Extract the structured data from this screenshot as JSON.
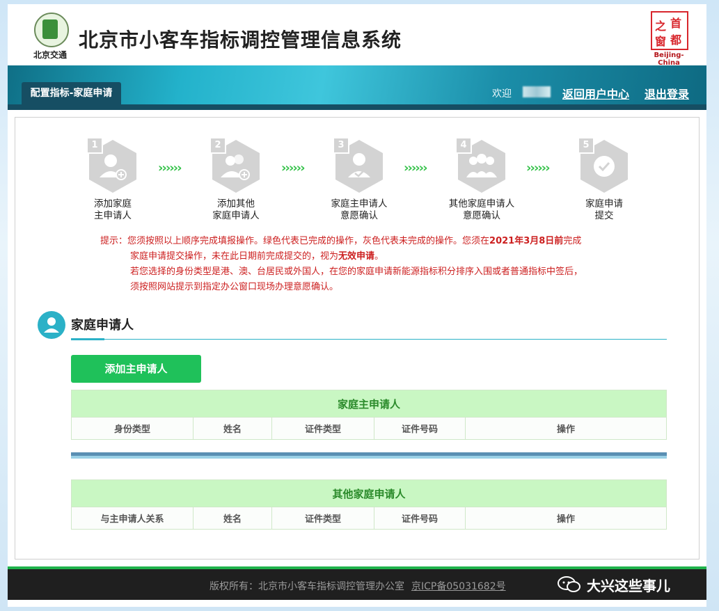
{
  "header": {
    "title": "北京市小客车指标调控管理信息系统",
    "logo_left_text": "北京交通",
    "logo_right_chars": [
      "首",
      "都",
      "之",
      "窗"
    ],
    "logo_right_caption": "Beijing-China"
  },
  "nav": {
    "active_tab": "配置指标-家庭申请",
    "welcome": "欢迎",
    "user_center": "返回用户中心",
    "logout": "退出登录"
  },
  "steps": [
    {
      "num": "1",
      "line1": "添加家庭",
      "line2": "主申请人",
      "icon": "add-user-icon"
    },
    {
      "num": "2",
      "line1": "添加其他",
      "line2": "家庭申请人",
      "icon": "add-users-icon"
    },
    {
      "num": "3",
      "line1": "家庭主申请人",
      "line2": "意愿确认",
      "icon": "user-check-icon"
    },
    {
      "num": "4",
      "line1": "其他家庭申请人",
      "line2": "意愿确认",
      "icon": "group-check-icon"
    },
    {
      "num": "5",
      "line1": "家庭申请",
      "line2": "提交",
      "icon": "check-circle-icon"
    }
  ],
  "step_arrows": "››››››",
  "tips": {
    "label": "提示：",
    "line1_a": "您须按照以上顺序完成填报操作。绿色代表已完成的操作，灰色代表未完成的操作。您须在",
    "line1_date": "2021年3月8日前",
    "line1_b": "完成",
    "line2_a": "家庭申请提交操作，未在此日期前完成提交的，视为",
    "line2_bold": "无效申请",
    "line2_b": "。",
    "line3": "若您选择的身份类型是港、澳、台居民或外国人，在您的家庭申请新能源指标积分排序入围或者普通指标中签后，",
    "line4": "须按照网站提示到指定办公窗口现场办理意愿确认。"
  },
  "section": {
    "title": "家庭申请人",
    "add_button": "添加主申请人"
  },
  "main_table": {
    "caption": "家庭主申请人",
    "columns": [
      "身份类型",
      "姓名",
      "证件类型",
      "证件号码",
      "操作"
    ]
  },
  "other_table": {
    "caption": "其他家庭申请人",
    "columns": [
      "与主申请人关系",
      "姓名",
      "证件类型",
      "证件号码",
      "操作"
    ]
  },
  "footer": {
    "copyright": "版权所有：北京市小客车指标调控管理办公室",
    "icp": "京ICP备05031682号",
    "watermark": "大兴这些事儿"
  },
  "colors": {
    "accent_teal": "#2bb1c7",
    "success_green": "#1fc15a",
    "tip_red": "#cc1f1f",
    "step_gray": "#d3d3d3"
  }
}
